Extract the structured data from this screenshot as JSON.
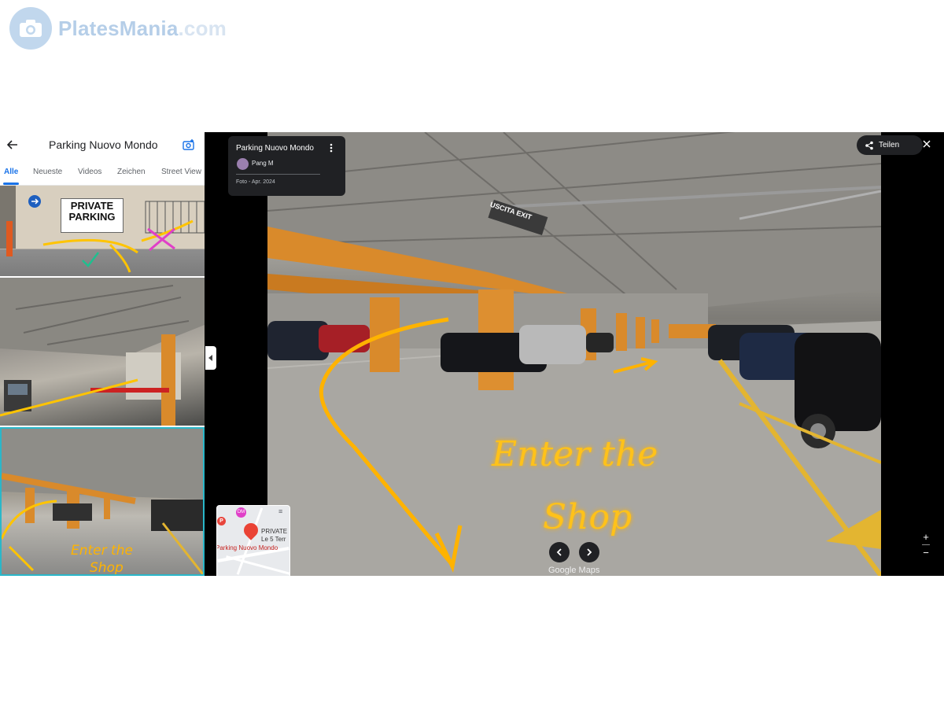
{
  "watermark": {
    "brand": "PlatesMania",
    "suffix": ".com"
  },
  "left_panel": {
    "title": "Parking Nuovo Mondo",
    "tabs": [
      {
        "label": "Alle",
        "active": true
      },
      {
        "label": "Neueste",
        "active": false
      },
      {
        "label": "Videos",
        "active": false
      },
      {
        "label": "Zeichen",
        "active": false
      },
      {
        "label": "Street View",
        "active": false
      }
    ],
    "thumb1_sign": "PRIVATE PARKING",
    "thumb3_annotation": "Enter the shop"
  },
  "viewer": {
    "info_card": {
      "title": "Parking Nuovo Mondo",
      "user": "Pang M",
      "date": "Foto - Apr. 2024"
    },
    "share_label": "Teilen",
    "overlay_text_line1": "Enter the",
    "overlay_text_line2": "Shop",
    "sign_uscita": "USCITA",
    "sign_exit": "EXIT",
    "attribution": "Google Maps",
    "minimap": {
      "label1": "PRIVATE",
      "label2": "Le 5 Terr",
      "place": "Parking Nuovo Mondo"
    }
  },
  "colors": {
    "accent_blue": "#1a73e8",
    "annotation_yellow": "#ffb300",
    "pillar_orange": "#d98a2b",
    "selected_thumb": "#2ab7c9"
  }
}
